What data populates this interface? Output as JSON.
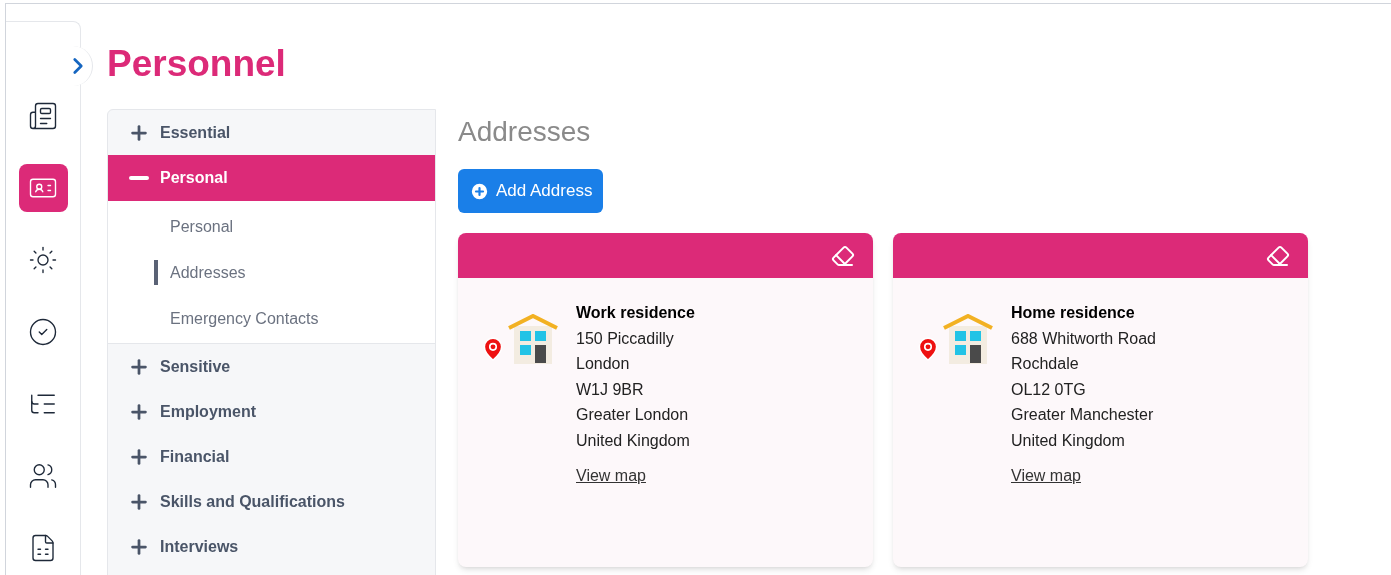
{
  "page_title": "Personnel",
  "rail": {
    "items": [
      {
        "selected": false
      },
      {
        "selected": true
      },
      {
        "selected": false
      },
      {
        "selected": false
      },
      {
        "selected": false
      },
      {
        "selected": false
      },
      {
        "selected": false
      }
    ]
  },
  "menu": [
    {
      "label": "Essential",
      "expanded": false,
      "selected": false
    },
    {
      "label": "Personal",
      "expanded": true,
      "selected": true,
      "children": [
        {
          "label": "Personal",
          "selected": false
        },
        {
          "label": "Addresses",
          "selected": true
        },
        {
          "label": "Emergency Contacts",
          "selected": false
        }
      ]
    },
    {
      "label": "Sensitive",
      "expanded": false,
      "selected": false
    },
    {
      "label": "Employment",
      "expanded": false,
      "selected": false
    },
    {
      "label": "Financial",
      "expanded": false,
      "selected": false
    },
    {
      "label": "Skills and Qualifications",
      "expanded": false,
      "selected": false
    },
    {
      "label": "Interviews",
      "expanded": false,
      "selected": false
    }
  ],
  "section_title": "Addresses",
  "add_button": "Add Address",
  "addresses": [
    {
      "title": "Work residence",
      "lines": [
        "150 Piccadilly",
        "London",
        "W1J 9BR",
        "Greater London",
        "United Kingdom"
      ],
      "link": "View map"
    },
    {
      "title": "Home residence",
      "lines": [
        "688 Whitworth Road",
        "Rochdale",
        "OL12 0TG",
        "Greater Manchester",
        "United Kingdom"
      ],
      "link": "View map"
    }
  ]
}
